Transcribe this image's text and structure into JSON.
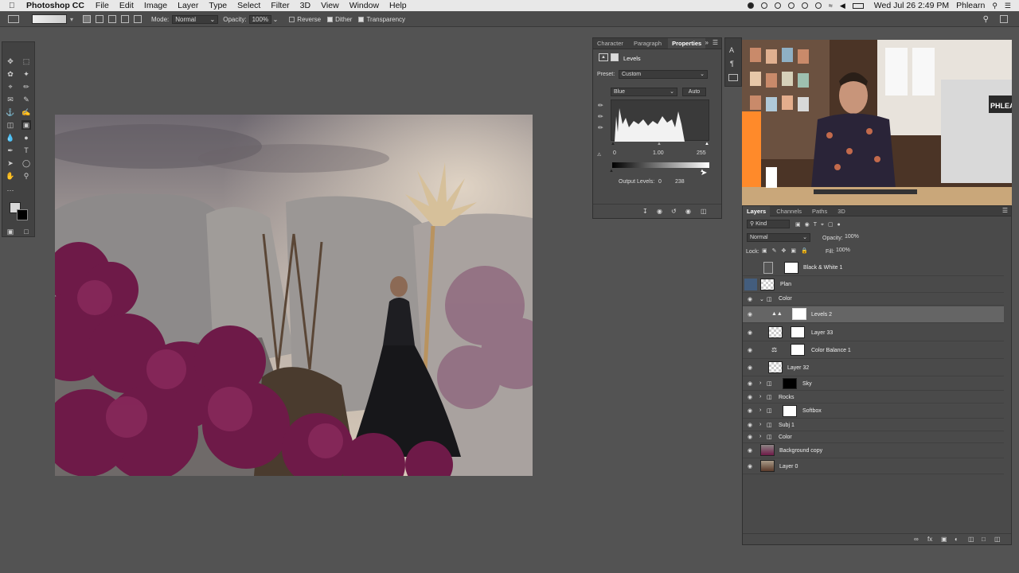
{
  "menubar": {
    "app": "Photoshop CC",
    "items": [
      "File",
      "Edit",
      "Image",
      "Layer",
      "Type",
      "Select",
      "Filter",
      "3D",
      "View",
      "Window",
      "Help"
    ],
    "clock": "Wed Jul 26  2:49 PM",
    "user": "Phlearn"
  },
  "options": {
    "mode_label": "Mode:",
    "mode_value": "Normal",
    "opacity_label": "Opacity:",
    "opacity_value": "100%",
    "reverse": "Reverse",
    "dither": "Dither",
    "transparency": "Transparency"
  },
  "properties": {
    "tabs": [
      "Character",
      "Paragraph",
      "Properties"
    ],
    "title": "Levels",
    "preset_label": "Preset:",
    "preset_value": "Custom",
    "channel": "Blue",
    "auto": "Auto",
    "input_black": "0",
    "input_gamma": "1.00",
    "input_white": "255",
    "output_label": "Output Levels:",
    "output_black": "0",
    "output_white": "238"
  },
  "video": {
    "sign_text": "PHLEA"
  },
  "layers_panel": {
    "tabs": [
      "Layers",
      "Channels",
      "Paths",
      "3D"
    ],
    "kind": "Kind",
    "blend": "Normal",
    "opacity_label": "Opacity:",
    "opacity_value": "100%",
    "lock_label": "Lock:",
    "fill_label": "Fill:",
    "fill_value": "100%",
    "layers": [
      {
        "name": "Black & White 1",
        "type": "adjustment",
        "visible": false
      },
      {
        "name": "Plan",
        "type": "pixel",
        "visible": false
      },
      {
        "name": "Color",
        "type": "group-open",
        "visible": true
      },
      {
        "name": "Levels 2",
        "type": "adjustment",
        "visible": true,
        "selected": true
      },
      {
        "name": "Layer 33",
        "type": "pixel-mask",
        "visible": true
      },
      {
        "name": "Color Balance 1",
        "type": "adjustment",
        "visible": true
      },
      {
        "name": "Layer 32",
        "type": "pixel",
        "visible": true
      },
      {
        "name": "Sky",
        "type": "group-mask",
        "visible": true
      },
      {
        "name": "Rocks",
        "type": "group",
        "visible": true
      },
      {
        "name": "Softbox",
        "type": "group-mask",
        "visible": true
      },
      {
        "name": "Subj 1",
        "type": "group",
        "visible": true
      },
      {
        "name": "Color",
        "type": "group",
        "visible": true
      },
      {
        "name": "Background copy",
        "type": "image",
        "visible": true
      },
      {
        "name": "Layer 0",
        "type": "image",
        "visible": true
      }
    ]
  },
  "colors": {
    "bg": "#535353",
    "panel": "#4a4a4a",
    "selected_row": "#656565",
    "flower": "#6e1a48"
  }
}
